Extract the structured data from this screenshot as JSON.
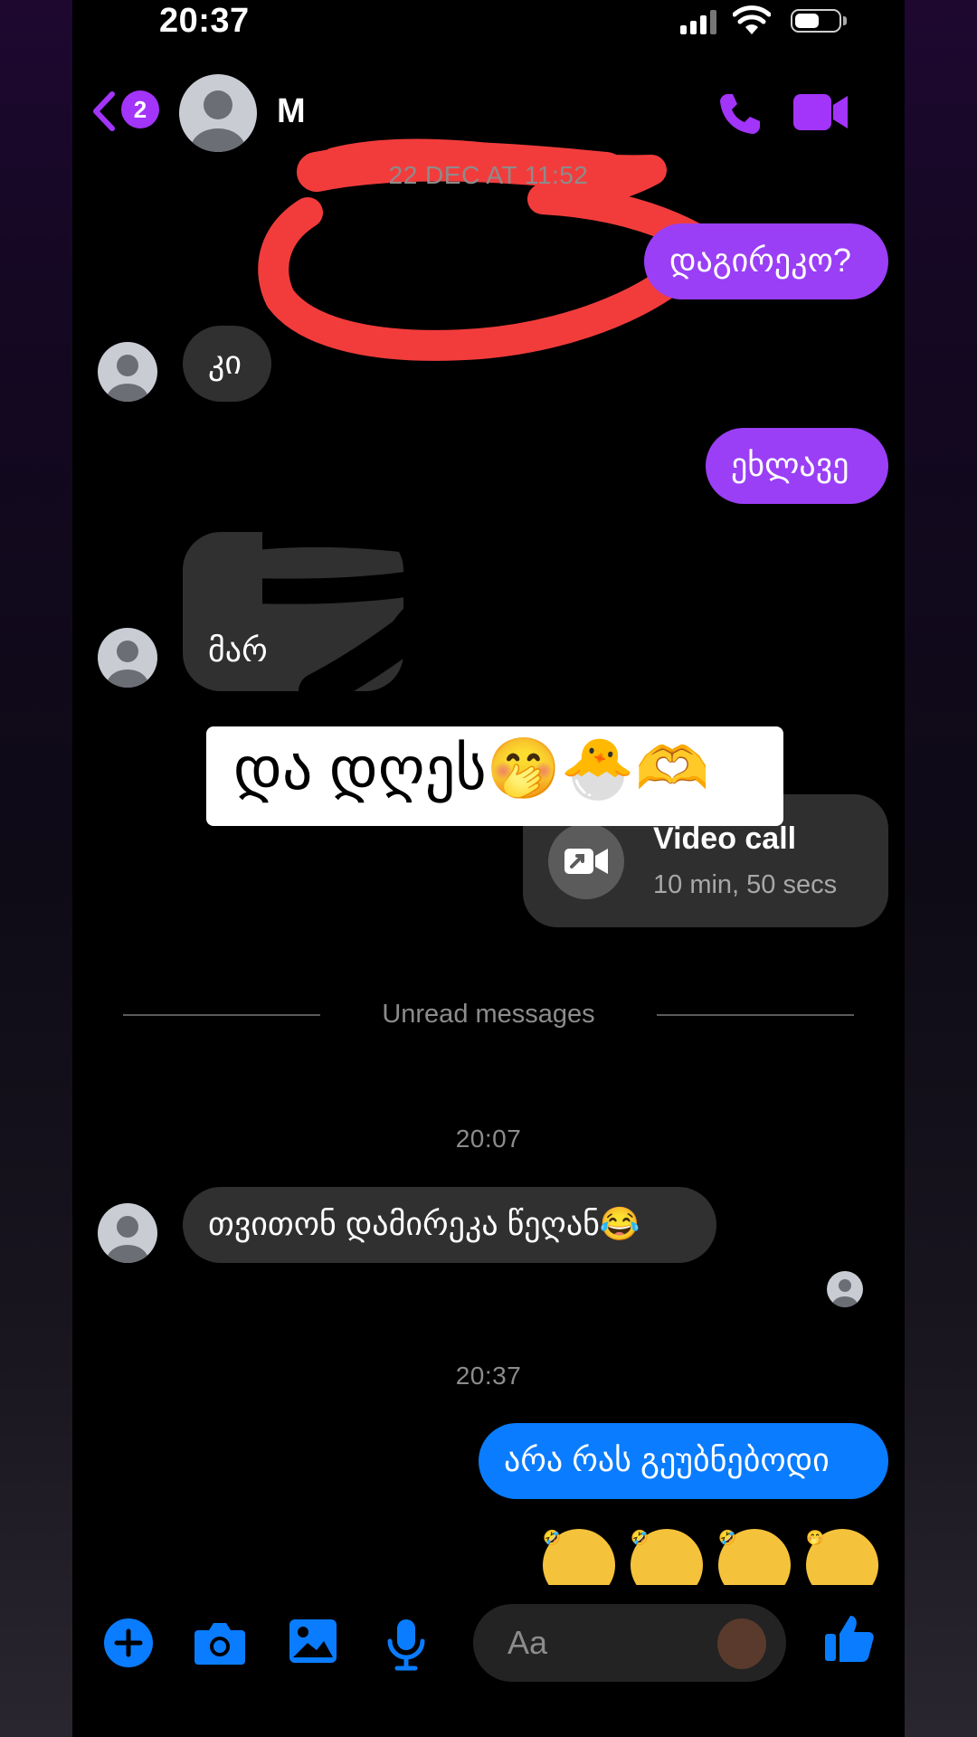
{
  "status_bar": {
    "time": "20:37"
  },
  "header": {
    "back_badge_count": "2",
    "contact_name": "M",
    "icons": [
      "chevron-left-icon",
      "phone-icon",
      "video-camera-icon"
    ]
  },
  "conversation": {
    "timestamp_1": "22 DEC AT 11:52",
    "msg_out_1": "დაგირეკო?",
    "msg_in_1": "კი",
    "msg_out_2": "ეხლავე",
    "msg_in_2": "მარ",
    "caption_overlay": "და დღეს🤭🐣🫶",
    "video_call": {
      "title": "Video call",
      "duration": "10 min, 50 secs"
    },
    "unread_divider": "Unread messages",
    "timestamp_2": "20:07",
    "msg_in_3": "თვითონ დამირეკა წეღან😂",
    "timestamp_3": "20:37",
    "msg_out_3": "არა რას გეუბნებოდი",
    "emoji_row": [
      "🤣",
      "🤣",
      "🤣",
      "🤭"
    ]
  },
  "composer": {
    "placeholder": "Aa",
    "icons": [
      "plus-icon",
      "camera-icon",
      "image-icon",
      "microphone-icon",
      "sticker-icon",
      "thumbs-up-icon"
    ]
  },
  "colors": {
    "accent_purple": "#9a3ff6",
    "accent_blue": "#0a7cff",
    "incoming_bubble": "#303030",
    "scribble_red": "#f23c3c"
  }
}
